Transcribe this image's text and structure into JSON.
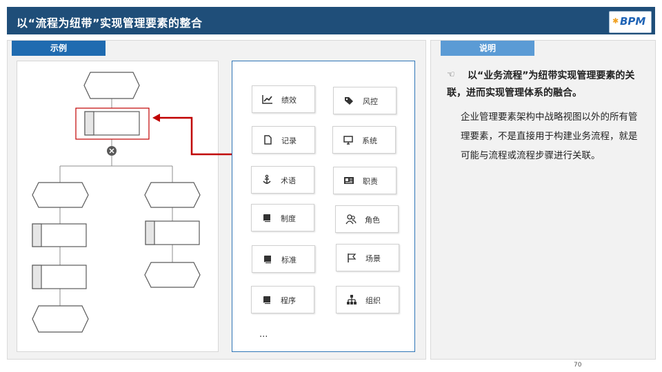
{
  "header": {
    "title": "以“流程为纽带”实现管理要素的整合"
  },
  "logo": {
    "text": "BPM"
  },
  "left_panel": {
    "tab_label": "示例"
  },
  "right_panel": {
    "tab_label": "说明"
  },
  "elements": [
    {
      "label": "绩效",
      "icon": "chart-line-icon"
    },
    {
      "label": "风控",
      "icon": "tag-icon"
    },
    {
      "label": "记录",
      "icon": "document-icon"
    },
    {
      "label": "系统",
      "icon": "monitor-icon"
    },
    {
      "label": "术语",
      "icon": "anchor-icon"
    },
    {
      "label": "职责",
      "icon": "id-card-icon"
    },
    {
      "label": "制度",
      "icon": "book-icon"
    },
    {
      "label": "角色",
      "icon": "users-icon"
    },
    {
      "label": "标准",
      "icon": "book-icon"
    },
    {
      "label": "场景",
      "icon": "flag-icon"
    },
    {
      "label": "程序",
      "icon": "book-icon"
    },
    {
      "label": "组织",
      "icon": "org-chart-icon"
    }
  ],
  "ellipsis": "...",
  "description": {
    "heading": "以“业务流程”为纽带实现管理要素的关联，进而实现管理体系的融合。",
    "body": "企业管理要素架构中战略视图以外的所有管理要素，不是直接用于构建业务流程，就是可能与流程或流程步骤进行关联。"
  },
  "page_number": "70",
  "colors": {
    "header_bg": "#1f4e79",
    "accent_blue": "#2e75b6",
    "highlight_red": "#c00000",
    "shape_border": "#595959"
  }
}
